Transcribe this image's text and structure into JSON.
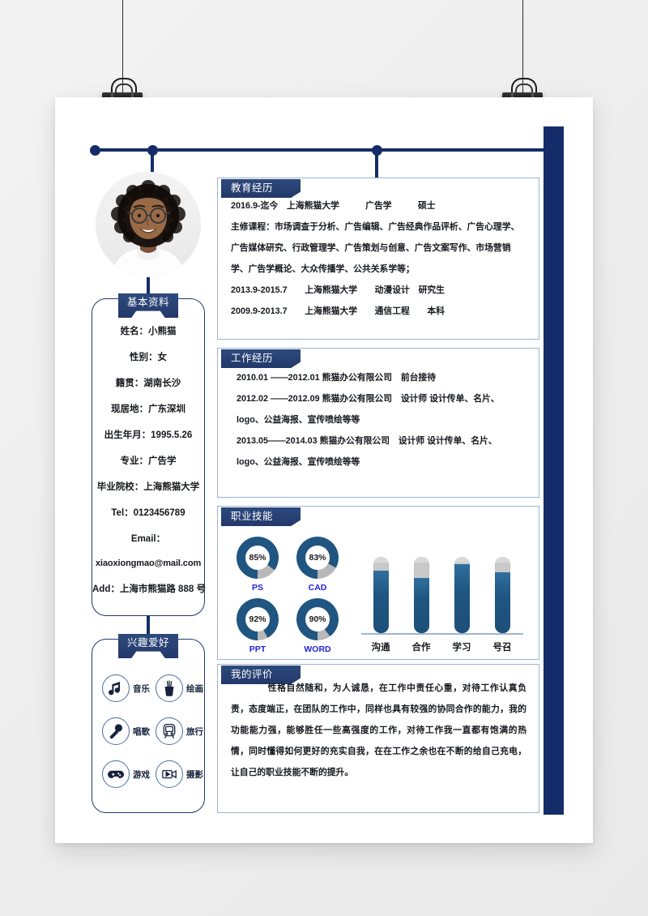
{
  "document": {
    "type": "resume-template",
    "accent_navy": "#142d68",
    "accent_blue": "#23386a",
    "skill_blue": "#1f5580",
    "label_blue": "#2222dd",
    "border_blue": "#9bb4d0"
  },
  "photo": {
    "alt": "profile-photo",
    "description": "smiling woman with curly hair and glasses"
  },
  "basic_info": {
    "title": "基本资料",
    "items": [
      "姓名：小熊猫",
      "性别：女",
      "籍贯：湖南长沙",
      "现居地：广东深圳",
      "出生年月：1995.5.26",
      "专业：广告学",
      "毕业院校：上海熊猫大学",
      "Tel：0123456789",
      "Email：",
      "xiaoxiongmao@mail.com",
      "Add：上海市熊猫路 888 号"
    ]
  },
  "hobbies": {
    "title": "兴趣爱好",
    "items": [
      {
        "label": "音乐",
        "icon": "music-note-icon"
      },
      {
        "label": "绘画",
        "icon": "paint-brush-cup-icon"
      },
      {
        "label": "唱歌",
        "icon": "microphone-icon"
      },
      {
        "label": "旅行",
        "icon": "train-icon"
      },
      {
        "label": "游戏",
        "icon": "gamepad-icon"
      },
      {
        "label": "摄影",
        "icon": "video-camera-icon"
      }
    ]
  },
  "education": {
    "title": "教育经历",
    "lines": [
      "2016.9-迄今　上海熊猫大学　　　广告学　　　硕士",
      "主修课程：市场调查于分析、广告编辑、广告经典作品评析、广告心理学、广告媒体研究、行政管理学、广告策划与创意、广告文案写作、市场营销学、广告学概论、大众传播学、公共关系学等；",
      "2013.9-2015.7　　上海熊猫大学　　动漫设计　研究生",
      "2009.9-2013.7　　上海熊猫大学　　通信工程　　本科"
    ]
  },
  "work": {
    "title": "工作经历",
    "lines": [
      "2010.01 ——2012.01 熊猫办公有限公司　前台接待",
      "2012.02 ——2012.09 熊猫办公有限公司　设计师 设计传单、名片、logo、公益海报、宣传喷绘等等",
      "2013.05——2014.03 熊猫办公有限公司　设计师 设计传单、名片、logo、公益海报、宣传喷绘等等"
    ]
  },
  "skills": {
    "title": "职业技能"
  },
  "evaluation": {
    "title": "我的评价",
    "text": "　　　　性格自然随和，为人诚恳，在工作中责任心重，对待工作认真负责，态度端正，在团队的工作中，同样也具有较强的协同合作的能力，我的功能能力强，能够胜任一些高强度的工作，对待工作我一直都有饱满的热情，同时懂得如何更好的充实自我，在在工作之余也在不断的给自己充电，让自己的职业技能不断的提升。"
  },
  "chart_data": [
    {
      "type": "pie",
      "title": "职业技能",
      "subtype": "donut-gauges",
      "categories": [
        "PS",
        "CAD",
        "PPT",
        "WORD"
      ],
      "values": [
        85,
        83,
        92,
        90
      ],
      "value_labels": [
        "85%",
        "83%",
        "92%",
        "90%"
      ],
      "unit": "%",
      "ylim": [
        0,
        100
      ],
      "filled_color": "#1f5580",
      "track_color": "#b8b8b8",
      "label_color": "#2222dd"
    },
    {
      "type": "bar",
      "title": "职业技能",
      "subtype": "test-tube-bars",
      "categories": [
        "沟通",
        "合作",
        "学习",
        "号召"
      ],
      "values": [
        82,
        72,
        90,
        80
      ],
      "ylim": [
        0,
        100
      ],
      "xlabel": "",
      "ylabel": "",
      "grid": false,
      "bar_color": "#1f5580",
      "track_color": "#c9c9c9"
    }
  ]
}
